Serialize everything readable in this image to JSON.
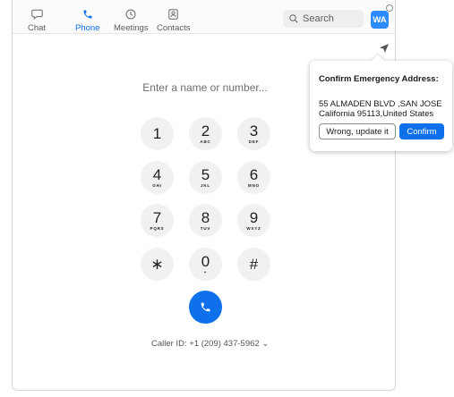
{
  "nav": {
    "tabs": [
      {
        "label": "Chat",
        "icon": "chat-bubble-icon",
        "active": false
      },
      {
        "label": "Phone",
        "icon": "phone-icon",
        "active": true
      },
      {
        "label": "Meetings",
        "icon": "clock-icon",
        "active": false
      },
      {
        "label": "Contacts",
        "icon": "contact-card-icon",
        "active": false
      }
    ],
    "search_label": "Search",
    "avatar_initials": "WA"
  },
  "dialpad": {
    "input_placeholder": "Enter a name or number...",
    "keys": [
      {
        "digit": "1",
        "letters": ""
      },
      {
        "digit": "2",
        "letters": "ABC"
      },
      {
        "digit": "3",
        "letters": "DEF"
      },
      {
        "digit": "4",
        "letters": "GHI"
      },
      {
        "digit": "5",
        "letters": "JKL"
      },
      {
        "digit": "6",
        "letters": "MNO"
      },
      {
        "digit": "7",
        "letters": "PQRS"
      },
      {
        "digit": "8",
        "letters": "TUV"
      },
      {
        "digit": "9",
        "letters": "WXYZ"
      },
      {
        "digit": "∗",
        "letters": ""
      },
      {
        "digit": "0",
        "letters": "+"
      },
      {
        "digit": "#",
        "letters": ""
      }
    ],
    "caller_id": "Caller ID: +1 (209) 437-5962",
    "caller_id_chevron": "⌄"
  },
  "popup": {
    "title": "Confirm Emergency Address:",
    "address_line1": "55 ALMADEN BLVD ,SAN JOSE",
    "address_line2": "California 95113,United States",
    "wrong_label": "Wrong, update it",
    "confirm_label": "Confirm"
  },
  "colors": {
    "accent": "#0e71eb",
    "avatar": "#2d8cff"
  }
}
